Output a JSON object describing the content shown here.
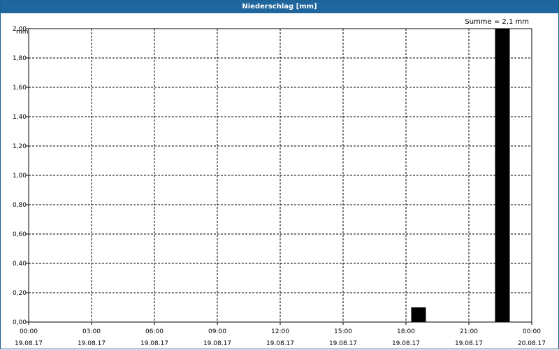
{
  "window": {
    "title": "Niederschlag [mm]"
  },
  "summary": {
    "text": "Summe = 2,1 mm"
  },
  "chart_data": {
    "type": "bar",
    "title": "Niederschlag [mm]",
    "ylabel": "mm",
    "xlabel": "",
    "ylim": [
      0,
      2.0
    ],
    "y_ticks": [
      "0,00",
      "0,20",
      "0,40",
      "0,60",
      "0,80",
      "1,00",
      "1,20",
      "1,40",
      "1,60",
      "1,80",
      "2,00"
    ],
    "x_ticks": [
      {
        "time": "00:00",
        "date": "19.08.17"
      },
      {
        "time": "03:00",
        "date": "19.08.17"
      },
      {
        "time": "06:00",
        "date": "19.08.17"
      },
      {
        "time": "09:00",
        "date": "19.08.17"
      },
      {
        "time": "12:00",
        "date": "19.08.17"
      },
      {
        "time": "15:00",
        "date": "19.08.17"
      },
      {
        "time": "18:00",
        "date": "19.08.17"
      },
      {
        "time": "21:00",
        "date": "19.08.17"
      },
      {
        "time": "00:00",
        "date": "20.08.17"
      }
    ],
    "series": [
      {
        "values": [
          {
            "x": "19.08.17 18:00",
            "y": 0.1
          },
          {
            "x": "19.08.17 22:00",
            "y": 2.0
          }
        ]
      }
    ],
    "grid": true,
    "bar_color": "#000000"
  }
}
